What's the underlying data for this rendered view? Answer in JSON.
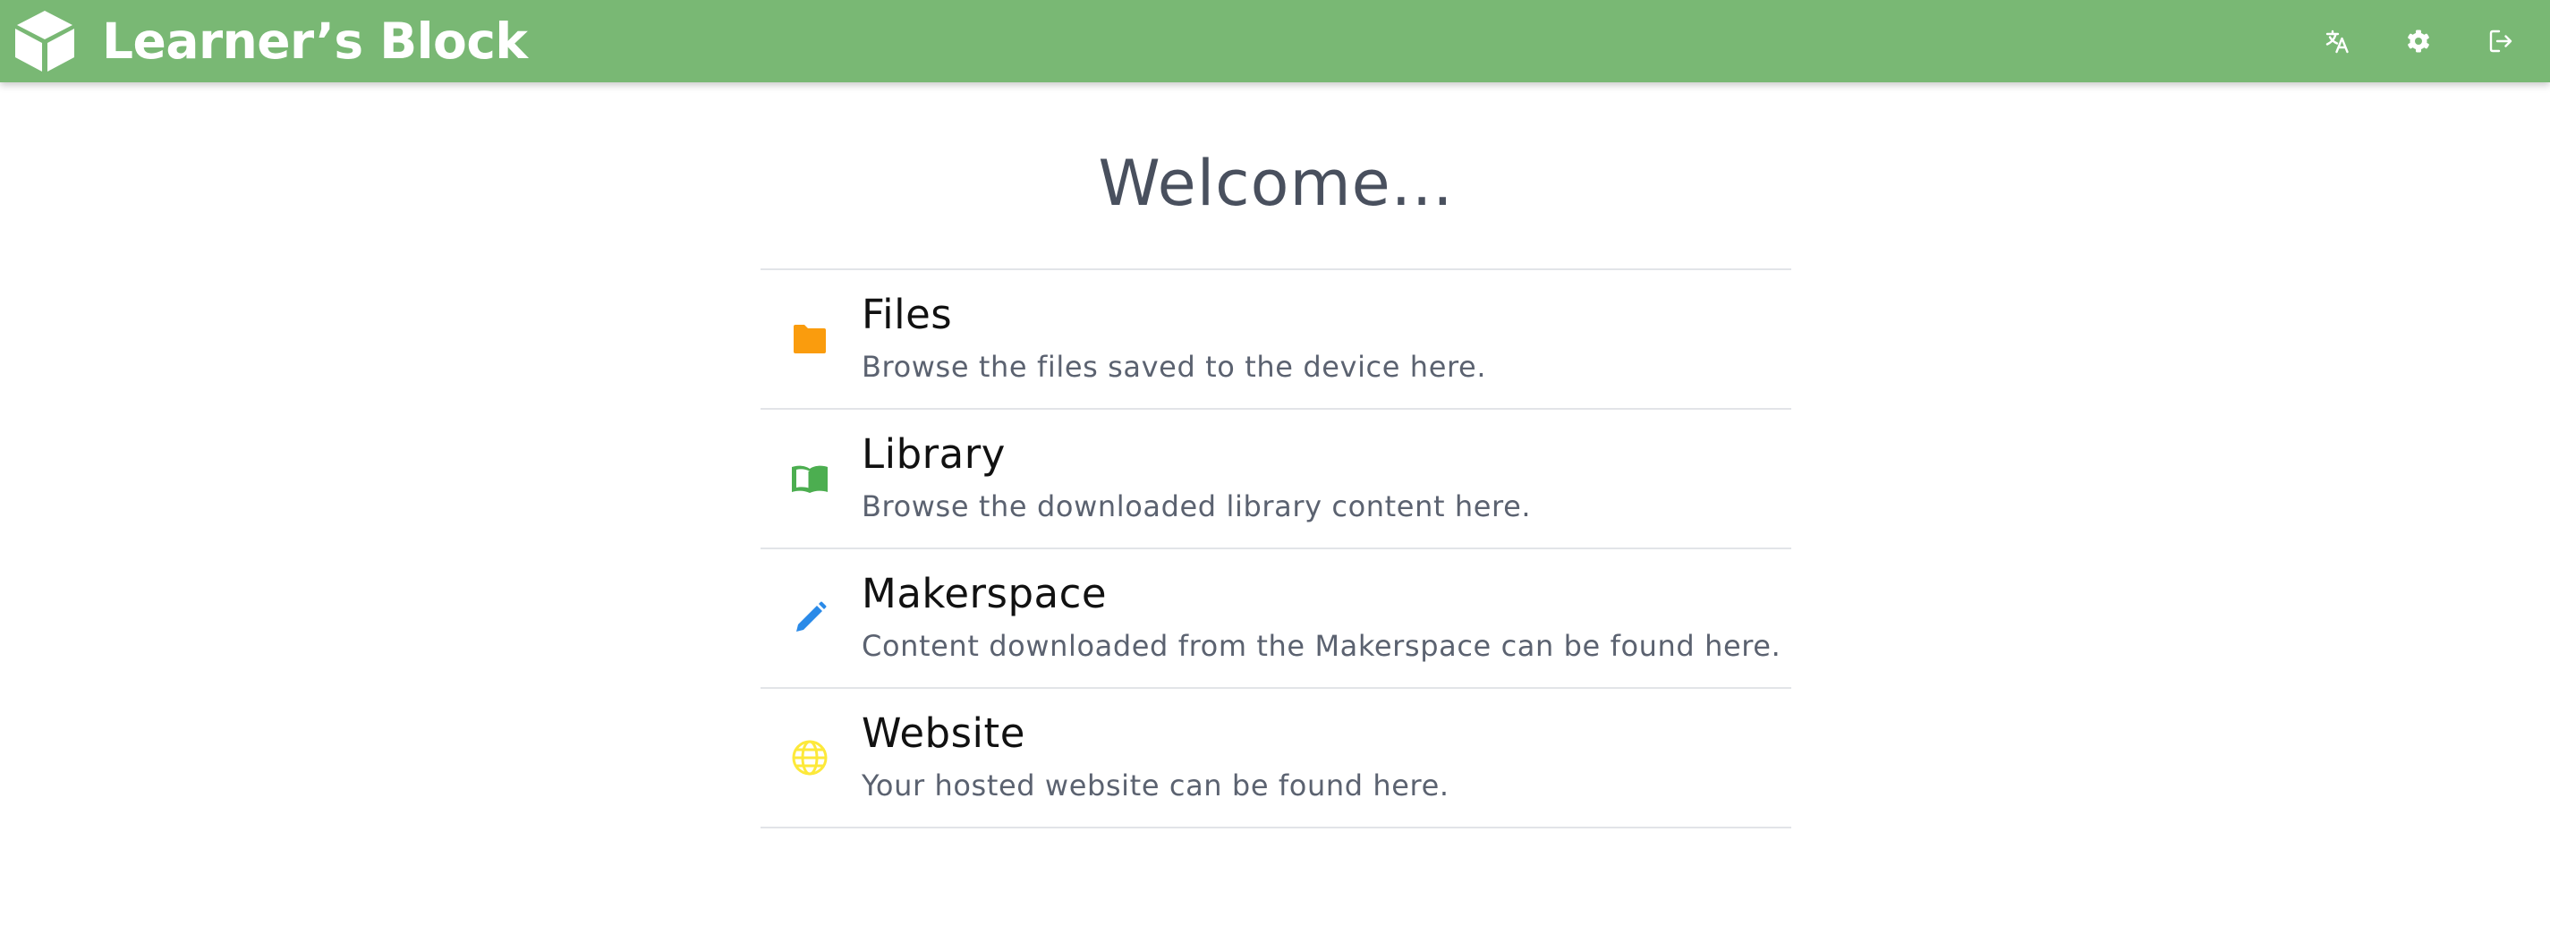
{
  "app": {
    "title": "Learner’s Block",
    "brand_color": "#79b874",
    "logo_icon": "cube-icon"
  },
  "header": {
    "actions": [
      {
        "name": "translate-button",
        "icon": "translate-icon"
      },
      {
        "name": "settings-button",
        "icon": "gear-icon"
      },
      {
        "name": "logout-button",
        "icon": "logout-icon"
      }
    ]
  },
  "main": {
    "heading": "Welcome...",
    "items": [
      {
        "title": "Files",
        "description": "Browse the files saved to the device here.",
        "icon": "folder-icon",
        "icon_color": "#fa9c0d"
      },
      {
        "title": "Library",
        "description": "Browse the downloaded library content here.",
        "icon": "book-icon",
        "icon_color": "#4cae50"
      },
      {
        "title": "Makerspace",
        "description": "Content downloaded from the Makerspace can be found here.",
        "icon": "pencil-icon",
        "icon_color": "#2a8ae8"
      },
      {
        "title": "Website",
        "description": "Your hosted website can be found here.",
        "icon": "globe-icon",
        "icon_color": "#fde93a"
      }
    ]
  }
}
